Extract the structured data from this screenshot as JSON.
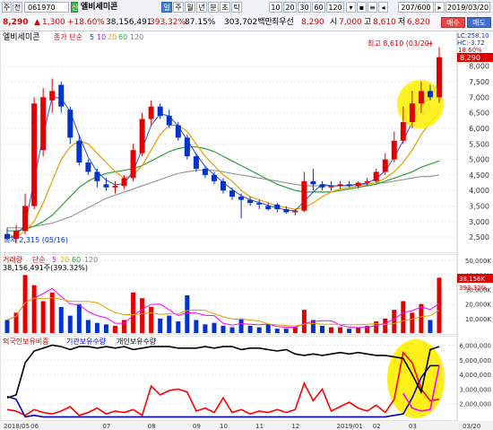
{
  "toolbar1": {
    "menu_label": "주",
    "menu2_label": "전",
    "code": "061970",
    "type_badge": "신",
    "stock_name": "엘비세미콘",
    "tab_daily": "일",
    "periods": [
      "주",
      "월",
      "년",
      "분",
      "초",
      "틱"
    ],
    "numbers": [
      "10",
      "20",
      "30",
      "60",
      "120"
    ],
    "count": "207/600",
    "date": "2019/03/20"
  },
  "toolbar2": {
    "price": "8,290",
    "change": "1,300",
    "change_pct": "+18.60%",
    "volume": "38,156,491",
    "vol_pct": "393.32%",
    "rate": "87.15%",
    "amount": "303,702백만",
    "preferred_label": "최우선",
    "preferred_price": "8,290",
    "ask_label": "시",
    "ask_price": "7,000",
    "high_label": "고",
    "high_price": "8,610",
    "low_label": "저",
    "low_price": "6,820",
    "buy_button": "매수",
    "sell_button": "매도"
  },
  "price_panel": {
    "name": "엘비세미콘",
    "legend_ma": "종가 단순",
    "ma_values": [
      "5",
      "10",
      "20",
      "60",
      "120"
    ],
    "high_note": "최고 8,610 (03/20)",
    "low_note": "최저 2,315 (05/16)",
    "lc_label": "LC:258.10",
    "hc_label": "HC:-3.72",
    "last_pct": "18.60%",
    "last_price": "8,290"
  },
  "volume_panel": {
    "legend": "거래량",
    "legend_ma": "단순",
    "ma_values": [
      "5",
      "20",
      "60",
      "120"
    ],
    "info": "38,156,491주(393.32%)",
    "last_volume": "38,156K",
    "last_pct": "393.32%"
  },
  "ownership_panel": {
    "legend_foreign": "외국인보유비중",
    "legend_inst": "기관보유수량",
    "legend_indiv": "개인보유수량"
  },
  "chart_data": [
    {
      "type": "candlestick",
      "title": "엘비세미콘",
      "x_labels": [
        "2018/05",
        "06",
        "07",
        "08",
        "09",
        "10",
        "11",
        "12",
        "2019/01",
        "02",
        "03"
      ],
      "x": [
        "2018-05-11",
        "2018-05-16",
        "2018-05-18",
        "2018-05-22",
        "2018-05-25",
        "2018-05-30",
        "2018-06-04",
        "2018-06-08",
        "2018-06-14",
        "2018-06-20",
        "2018-06-26",
        "2018-07-02",
        "2018-07-09",
        "2018-07-16",
        "2018-07-23",
        "2018-07-30",
        "2018-08-06",
        "2018-08-13",
        "2018-08-20",
        "2018-08-27",
        "2018-09-03",
        "2018-09-10",
        "2018-09-17",
        "2018-09-28",
        "2018-10-05",
        "2018-10-12",
        "2018-10-19",
        "2018-10-26",
        "2018-11-02",
        "2018-11-09",
        "2018-11-16",
        "2018-11-23",
        "2018-11-30",
        "2018-12-07",
        "2018-12-14",
        "2018-12-21",
        "2018-12-28",
        "2019-01-07",
        "2019-01-14",
        "2019-01-21",
        "2019-01-28",
        "2019-02-08",
        "2019-02-15",
        "2019-02-22",
        "2019-03-04",
        "2019-03-08",
        "2019-03-14",
        "2019-03-19",
        "2019-03-20"
      ],
      "open": [
        2600,
        2450,
        2700,
        3500,
        5300,
        6900,
        7400,
        6600,
        5600,
        4900,
        4600,
        4200,
        4100,
        4150,
        4400,
        5200,
        6300,
        6700,
        6400,
        6100,
        5700,
        5100,
        4700,
        4500,
        4300,
        4000,
        3800,
        3700,
        3600,
        3500,
        3550,
        3400,
        3300,
        3350,
        4300,
        4200,
        4100,
        4150,
        4200,
        4150,
        4250,
        4300,
        4600,
        5000,
        5600,
        6200,
        6800,
        7200,
        7000
      ],
      "high": [
        2800,
        2900,
        3900,
        7000,
        7300,
        7600,
        7500,
        6700,
        5800,
        5000,
        4700,
        4400,
        4300,
        4500,
        5500,
        6500,
        6900,
        6800,
        6600,
        6200,
        5800,
        5200,
        4800,
        4600,
        4400,
        4100,
        3900,
        3800,
        3700,
        3600,
        3600,
        3500,
        3400,
        4600,
        4700,
        4300,
        4300,
        4300,
        4300,
        4300,
        4400,
        4700,
        5200,
        5900,
        6700,
        7200,
        7500,
        7400,
        8610
      ],
      "low": [
        2400,
        2315,
        2600,
        3400,
        5100,
        6500,
        6500,
        5500,
        4800,
        4500,
        4100,
        4000,
        3900,
        4050,
        4300,
        5100,
        6100,
        6300,
        6000,
        5600,
        5000,
        4600,
        4400,
        4200,
        3900,
        3700,
        3100,
        3500,
        3400,
        3350,
        3300,
        3250,
        3200,
        3300,
        4000,
        4000,
        4000,
        4050,
        4100,
        4050,
        4150,
        4250,
        4500,
        4900,
        5500,
        6000,
        6500,
        6900,
        6820
      ],
      "close": [
        2450,
        2700,
        3500,
        6800,
        7000,
        7200,
        6700,
        5700,
        4900,
        4600,
        4300,
        4100,
        4150,
        4400,
        5300,
        6300,
        6700,
        6400,
        6100,
        5700,
        5100,
        4700,
        4500,
        4300,
        4000,
        3800,
        3700,
        3600,
        3550,
        3400,
        3400,
        3300,
        3350,
        4300,
        4200,
        4100,
        4150,
        4200,
        4150,
        4250,
        4300,
        4600,
        5000,
        5600,
        6200,
        6800,
        7200,
        7000,
        8290
      ],
      "ylim": [
        2100,
        8800
      ],
      "y_ticks": [
        2500,
        3000,
        3500,
        4000,
        4500,
        5000,
        5500,
        6000,
        6500,
        7000,
        7500,
        8000
      ],
      "y_tick_labels": [
        "2,500",
        "3,000",
        "3,500",
        "4,000",
        "4,500",
        "5,000",
        "5,500",
        "6,000",
        "6,500",
        "7,000",
        "7,500",
        "8,000"
      ],
      "ma20": [
        2600,
        2500,
        2700,
        3000,
        3600,
        4300,
        5000,
        5400,
        5600,
        5500,
        5200,
        4900,
        4600,
        4400,
        4500,
        4800,
        5300,
        5800,
        6100,
        6100,
        5900,
        5500,
        5100,
        4800,
        4500,
        4300,
        4000,
        3800,
        3700,
        3600,
        3500,
        3450,
        3400,
        3450,
        3600,
        3800,
        3950,
        4050,
        4100,
        4150,
        4200,
        4250,
        4400,
        4600,
        4900,
        5300,
        5800,
        6200,
        6500
      ],
      "ma60": [
        2700,
        2700,
        2750,
        2850,
        3000,
        3200,
        3500,
        3800,
        4100,
        4300,
        4450,
        4550,
        4600,
        4650,
        4700,
        4800,
        4950,
        5100,
        5250,
        5350,
        5400,
        5400,
        5350,
        5250,
        5100,
        4950,
        4800,
        4650,
        4500,
        4350,
        4200,
        4100,
        4000,
        3950,
        3950,
        3950,
        3950,
        4000,
        4050,
        4100,
        4150,
        4200,
        4300,
        4400,
        4500,
        4600,
        4750,
        4850,
        4950
      ],
      "ma120": [
        2800,
        2800,
        2800,
        2850,
        2900,
        2950,
        3050,
        3150,
        3300,
        3450,
        3600,
        3750,
        3850,
        3950,
        4050,
        4150,
        4250,
        4350,
        4450,
        4550,
        4600,
        4650,
        4650,
        4650,
        4600,
        4550,
        4500,
        4450,
        4400,
        4350,
        4300,
        4250,
        4200,
        4150,
        4150,
        4150,
        4150,
        4150,
        4150,
        4200,
        4200,
        4250,
        4250,
        4300,
        4350,
        4400,
        4450,
        4450,
        4500
      ],
      "high_marker": {
        "value": 8610,
        "label": "최고 8,610 (03/20)"
      },
      "low_marker": {
        "value": 2315,
        "label": "최저 2,315 (05/16)"
      }
    },
    {
      "type": "bar",
      "title": "거래량",
      "values": [
        9000,
        14000,
        40000,
        33000,
        22000,
        28000,
        18000,
        12000,
        20000,
        9000,
        7000,
        6000,
        5000,
        9000,
        28000,
        24000,
        18000,
        10000,
        12000,
        8000,
        26000,
        9000,
        6000,
        7000,
        5000,
        4000,
        10000,
        5000,
        4000,
        6000,
        3000,
        3000,
        4000,
        16000,
        9000,
        5000,
        4000,
        4000,
        3000,
        4000,
        5000,
        8000,
        10000,
        16000,
        22000,
        14000,
        20000,
        9000,
        38156
      ],
      "ylim": [
        0,
        52000
      ],
      "y_ticks": [
        10000,
        20000,
        30000,
        40000,
        50000
      ],
      "y_tick_labels": [
        "10,000K",
        "20,000K",
        "30,000K",
        "40,000K",
        "50,000K"
      ]
    },
    {
      "type": "line",
      "title": "외국인보유비중 / 기관보유수량 / 개인보유수량",
      "series": [
        {
          "name": "외국인보유비중",
          "color": "#ff0000",
          "values": [
            1.6,
            1.5,
            1.2,
            1.6,
            1.4,
            1.3,
            1.5,
            1.8,
            1.2,
            1.4,
            1.7,
            1.3,
            1.5,
            1.4,
            1.6,
            1.2,
            3.2,
            2.6,
            2.9,
            3.0,
            2.8,
            1.5,
            1.7,
            1.4,
            2.4,
            1.4,
            1.6,
            1.3,
            1.5,
            1.4,
            1.6,
            1.4,
            1.6,
            3.4,
            2.2,
            3.0,
            1.5,
            1.8,
            2.1,
            1.7,
            1.5,
            1.9,
            1.4,
            2.3,
            5.5,
            4.8,
            3.0,
            2.2,
            2.3
          ]
        },
        {
          "name": "기관보유수량",
          "color": "#0000d0",
          "values": [
            2.5,
            2.3,
            1.1,
            1.2,
            1.1,
            1.1,
            1.1,
            1.1,
            1.1,
            1.1,
            1.1,
            1.1,
            1.1,
            1.1,
            1.1,
            1.1,
            1.1,
            1.1,
            1.1,
            1.1,
            1.1,
            1.1,
            1.1,
            1.1,
            1.1,
            1.1,
            1.1,
            1.1,
            1.1,
            1.1,
            1.1,
            1.1,
            1.1,
            1.1,
            1.1,
            1.1,
            1.1,
            1.1,
            1.1,
            1.1,
            1.1,
            1.1,
            1.1,
            1.2,
            1.3,
            2.4,
            3.8,
            4.6,
            4.6
          ]
        },
        {
          "name": "개인보유수량",
          "color": "#000000",
          "values": [
            2.4,
            2.6,
            4.8,
            5.6,
            5.8,
            6.0,
            5.9,
            5.7,
            5.9,
            5.9,
            5.8,
            5.9,
            5.8,
            5.9,
            5.7,
            5.8,
            5.9,
            5.9,
            5.9,
            5.8,
            5.8,
            5.8,
            5.9,
            5.8,
            5.9,
            5.9,
            5.7,
            5.8,
            5.8,
            5.7,
            5.6,
            5.7,
            5.4,
            5.3,
            5.4,
            5.3,
            5.4,
            5.5,
            5.4,
            5.5,
            5.4,
            5.3,
            5.3,
            5.2,
            5.1,
            4.0,
            2.8,
            5.7,
            5.9
          ]
        },
        {
          "name": "magenta",
          "color": "#ff00ff",
          "values": [
            null,
            null,
            null,
            null,
            null,
            null,
            null,
            null,
            null,
            null,
            null,
            null,
            null,
            null,
            null,
            null,
            null,
            null,
            null,
            null,
            null,
            null,
            null,
            null,
            null,
            null,
            null,
            null,
            null,
            null,
            null,
            null,
            null,
            null,
            null,
            null,
            null,
            null,
            null,
            null,
            null,
            null,
            null,
            null,
            2.7,
            1.7,
            1.5,
            1.6,
            4.6
          ]
        }
      ],
      "ylim": [
        1000000,
        6400000
      ],
      "y_ticks": [
        2000000,
        3000000,
        4000000,
        5000000,
        6000000
      ],
      "y_tick_labels": [
        "2,000,000",
        "3,000,000",
        "4,000,000",
        "5,000,000",
        "6,000,000"
      ],
      "x_tick_labels": [
        "2018/05",
        "06",
        "07",
        "08",
        "09",
        "10",
        "11",
        "12",
        "2019/01",
        "02",
        "03",
        "03/20"
      ]
    }
  ]
}
